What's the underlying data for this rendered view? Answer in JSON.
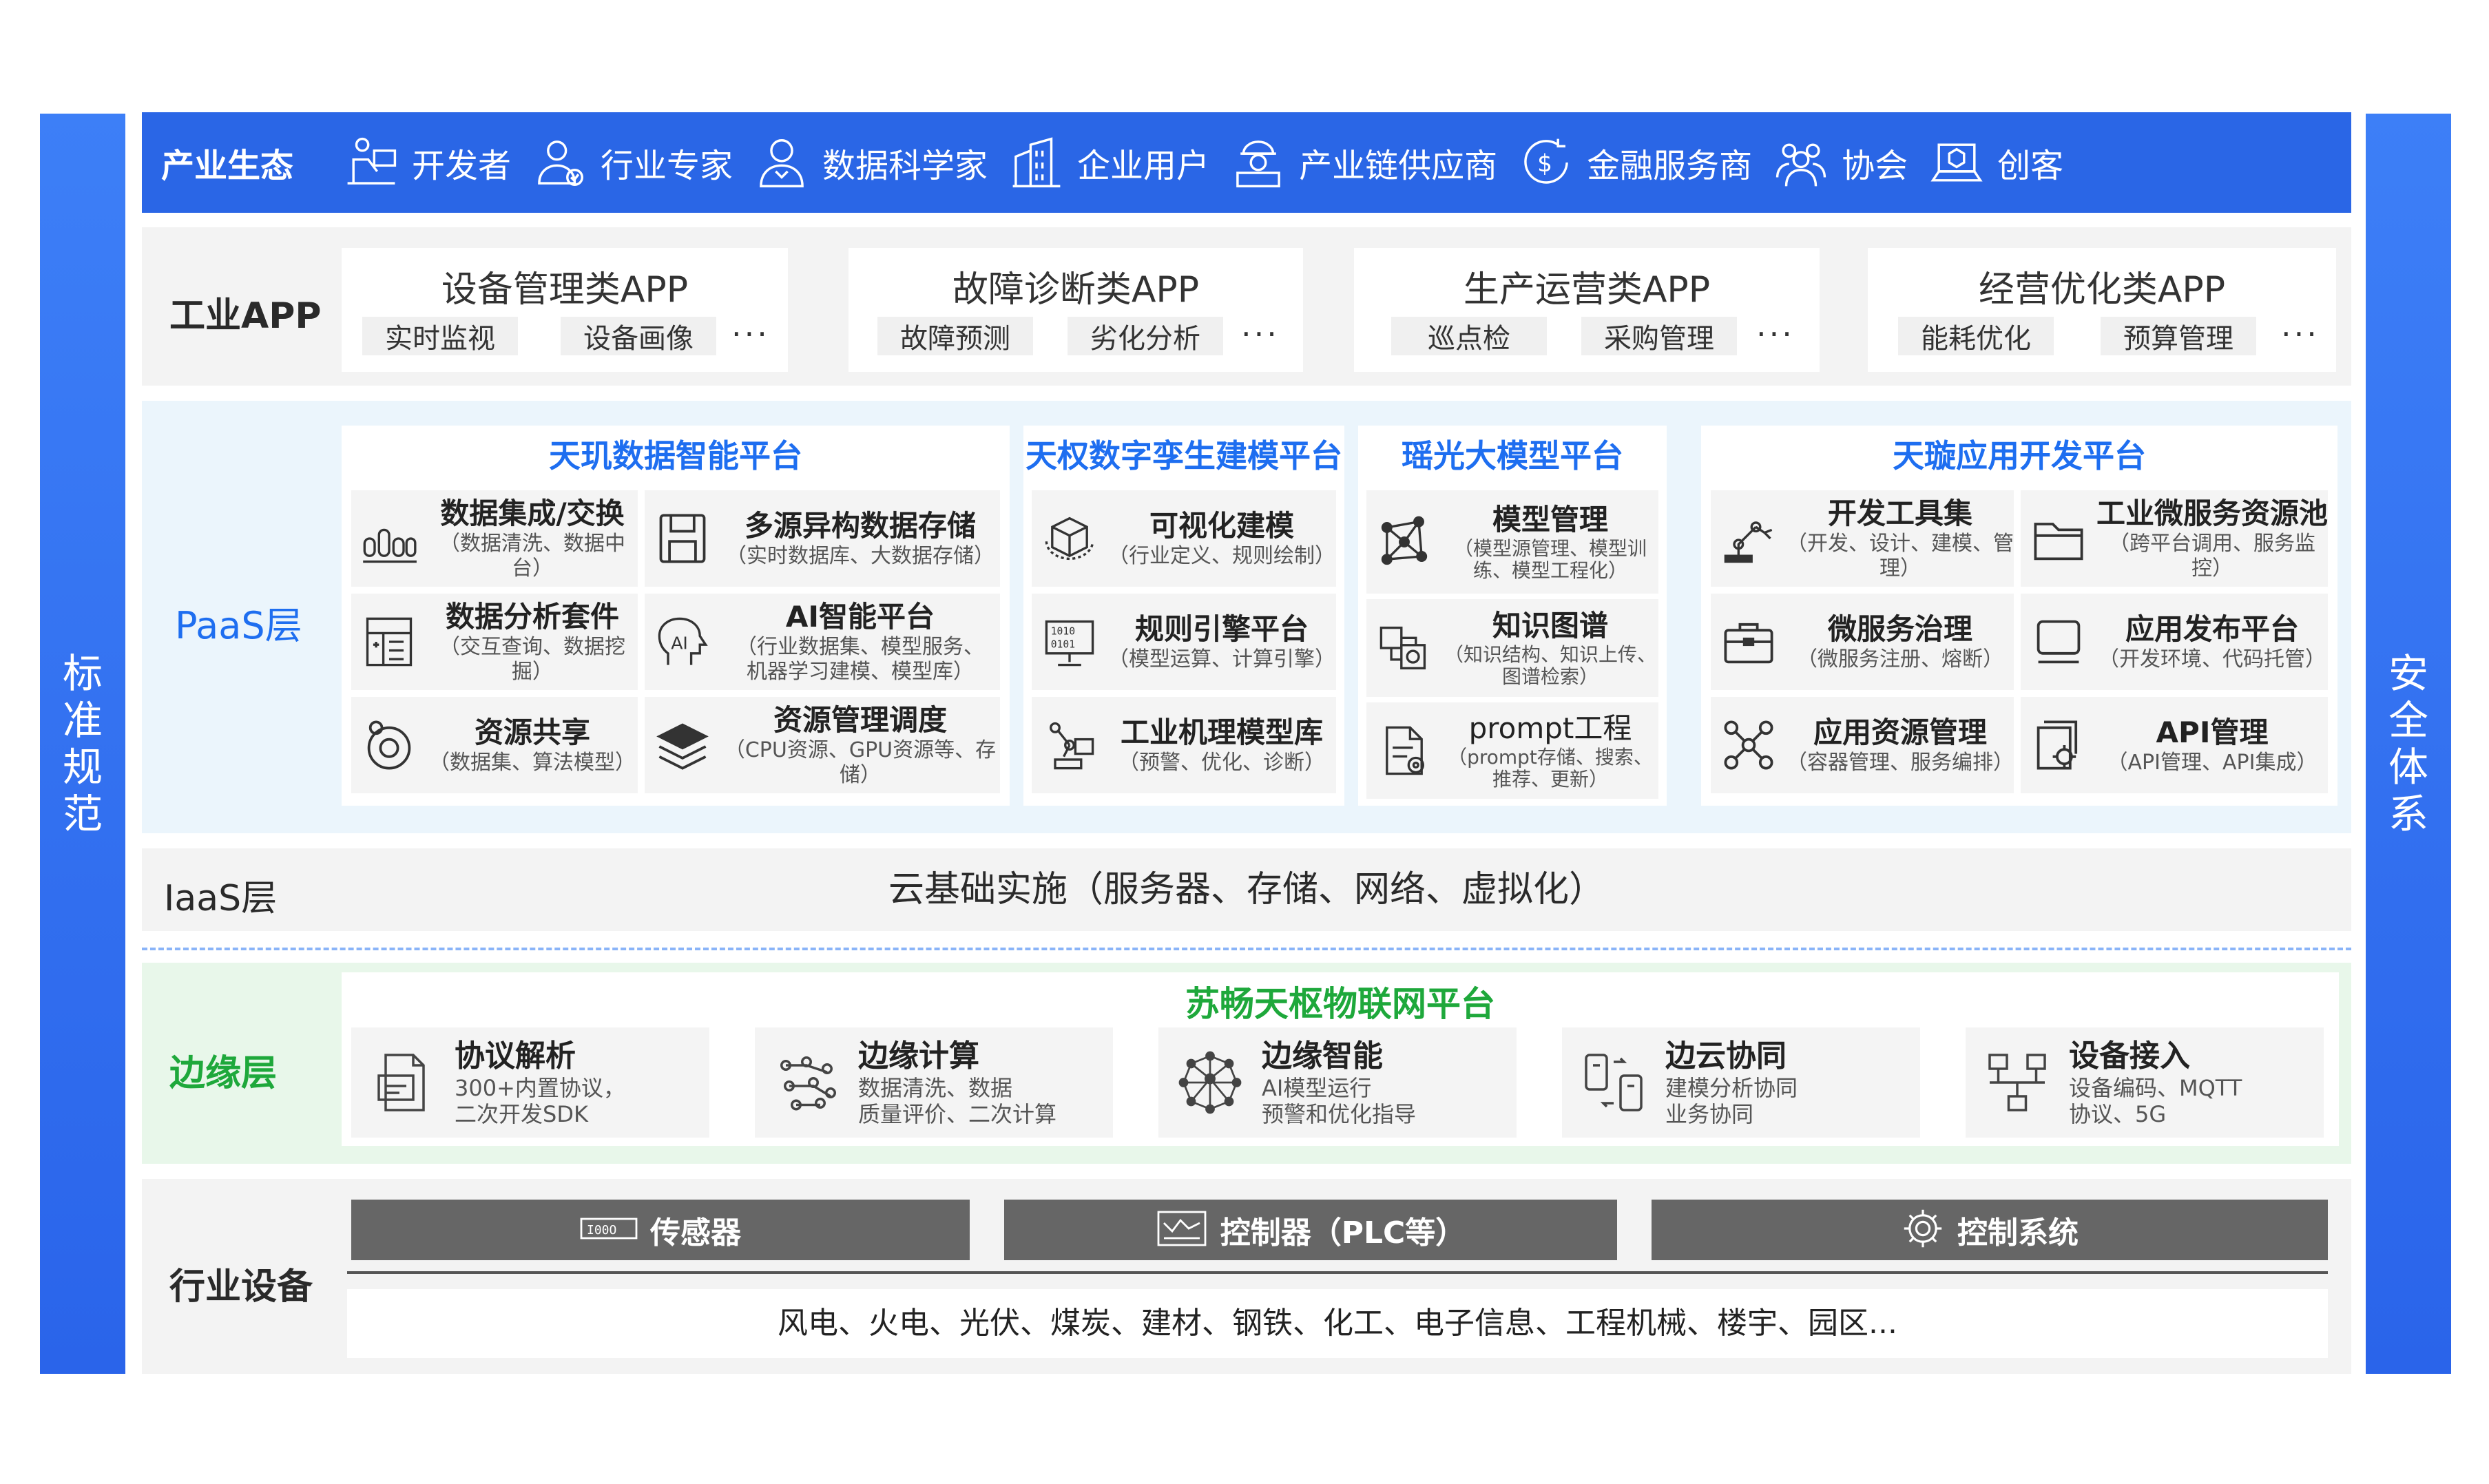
{
  "left_bar": {
    "label": "标准规范"
  },
  "right_bar": {
    "label": "安全体系"
  },
  "ecosystem": {
    "title": "产业生态",
    "items": [
      {
        "icon": "developer-icon",
        "label": "开发者"
      },
      {
        "icon": "expert-icon",
        "label": "行业专家"
      },
      {
        "icon": "data-scientist-icon",
        "label": "数据科学家"
      },
      {
        "icon": "enterprise-icon",
        "label": "企业用户"
      },
      {
        "icon": "supplier-icon",
        "label": "产业链供应商"
      },
      {
        "icon": "finance-icon",
        "label": "金融服务商"
      },
      {
        "icon": "association-icon",
        "label": "协会"
      },
      {
        "icon": "maker-icon",
        "label": "创客"
      }
    ]
  },
  "app_layer": {
    "title": "工业APP",
    "cards": [
      {
        "title": "设备管理类APP",
        "tags": [
          "实时监视",
          "设备画像"
        ],
        "more": "···"
      },
      {
        "title": "故障诊断类APP",
        "tags": [
          "故障预测",
          "劣化分析"
        ],
        "more": "···"
      },
      {
        "title": "生产运营类APP",
        "tags": [
          "巡点检",
          "采购管理"
        ],
        "more": "···"
      },
      {
        "title": "经营优化类APP",
        "tags": [
          "能耗优化",
          "预算管理"
        ],
        "more": "···"
      }
    ]
  },
  "paas_layer": {
    "title": "PaaS层",
    "groups": [
      {
        "title": "天玑数据智能平台",
        "items": [
          {
            "icon": "data-integration-icon",
            "name": "数据集成/交换",
            "desc": "（数据清洗、数据中台）"
          },
          {
            "icon": "storage-icon",
            "name": "多源异构数据存储",
            "desc": "（实时数据库、大数据存储）"
          },
          {
            "icon": "analysis-icon",
            "name": "数据分析套件",
            "desc": "（交互查询、数据挖掘）"
          },
          {
            "icon": "ai-head-icon",
            "name": "AI智能平台",
            "desc": "（行业数据集、模型服务、机器学习建模、模型库）"
          },
          {
            "icon": "share-icon",
            "name": "资源共享",
            "desc": "（数据集、算法模型）"
          },
          {
            "icon": "layers-icon",
            "name": "资源管理调度",
            "desc": "（CPU资源、GPU资源等、存储）"
          }
        ]
      },
      {
        "title": "天权数字孪生建模平台",
        "items": [
          {
            "icon": "cube-icon",
            "name": "可视化建模",
            "desc": "（行业定义、规则绘制）"
          },
          {
            "icon": "rule-engine-icon",
            "name": "规则引擎平台",
            "desc": "（模型运算、计算引擎）"
          },
          {
            "icon": "robot-arm-icon",
            "name": "工业机理模型库",
            "desc": "（预警、优化、诊断）"
          }
        ]
      },
      {
        "title": "瑶光大模型平台",
        "items": [
          {
            "icon": "model-network-icon",
            "name": "模型管理",
            "desc": "（模型源管理、模型训练、模型工程化）"
          },
          {
            "icon": "knowledge-graph-icon",
            "name": "知识图谱",
            "desc": "（知识结构、知识上传、图谱检索）"
          },
          {
            "icon": "prompt-doc-icon",
            "name": "prompt工程",
            "desc": "（prompt存储、搜索、推荐、更新）"
          }
        ]
      },
      {
        "title": "天璇应用开发平台",
        "items": [
          {
            "icon": "dev-tools-icon",
            "name": "开发工具集",
            "desc": "（开发、设计、建模、管理）"
          },
          {
            "icon": "folder-icon",
            "name": "工业微服务资源池",
            "desc": "（跨平台调用、服务监控）"
          },
          {
            "icon": "briefcase-icon",
            "name": "微服务治理",
            "desc": "（微服务注册、熔断）"
          },
          {
            "icon": "monitor-icon",
            "name": "应用发布平台",
            "desc": "（开发环境、代码托管）"
          },
          {
            "icon": "nodes-icon",
            "name": "应用资源管理",
            "desc": "（容器管理、服务编排）"
          },
          {
            "icon": "api-settings-icon",
            "name": "API管理",
            "desc": "（API管理、API集成）"
          }
        ]
      }
    ]
  },
  "iaas_layer": {
    "title": "IaaS层",
    "content": "云基础实施（服务器、存储、网络、虚拟化）"
  },
  "edge_layer": {
    "title": "边缘层",
    "platform": "苏畅天枢物联网平台",
    "items": [
      {
        "icon": "protocol-doc-icon",
        "name": "协议解析",
        "lines": [
          "300+内置协议，",
          "二次开发SDK"
        ]
      },
      {
        "icon": "edge-compute-icon",
        "name": "边缘计算",
        "lines": [
          "数据清洗、数据",
          "质量评价、二次计算"
        ]
      },
      {
        "icon": "neural-net-icon",
        "name": "边缘智能",
        "lines": [
          "AI模型运行",
          "预警和优化指导"
        ]
      },
      {
        "icon": "sync-devices-icon",
        "name": "边云协同",
        "lines": [
          "建模分析协同",
          "业务协同"
        ]
      },
      {
        "icon": "device-access-icon",
        "name": "设备接入",
        "lines": [
          "设备编码、MQTT",
          "协议、5G"
        ]
      }
    ]
  },
  "device_layer": {
    "title": "行业设备",
    "bars": [
      {
        "icon": "sensor-icon",
        "name": "传感器"
      },
      {
        "icon": "controller-icon",
        "name": "控制器（PLC等）"
      },
      {
        "icon": "gear-icon",
        "name": "控制系统"
      }
    ],
    "industries": "风电、火电、光伏、煤炭、建材、钢铁、化工、电子信息、工程机械、楼宇、园区..."
  }
}
